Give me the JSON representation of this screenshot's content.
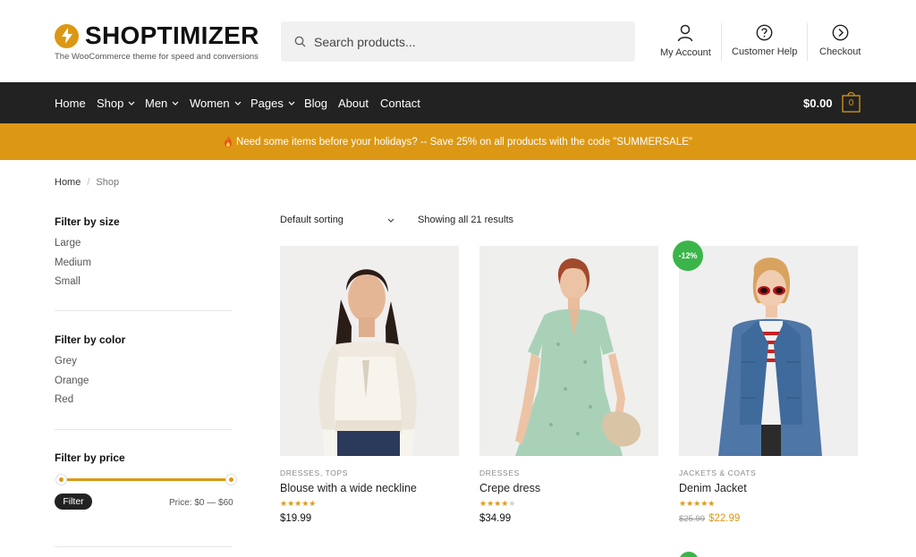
{
  "brand": {
    "name": "SHOPTIMIZER",
    "tagline": "The WooCommerce theme for speed and conversions"
  },
  "search": {
    "placeholder": "Search products..."
  },
  "header_links": {
    "account": "My Account",
    "help": "Customer Help",
    "checkout": "Checkout"
  },
  "nav": {
    "items": [
      {
        "label": "Home"
      },
      {
        "label": "Shop"
      },
      {
        "label": "Men"
      },
      {
        "label": "Women"
      },
      {
        "label": "Pages"
      },
      {
        "label": "Blog"
      },
      {
        "label": "About"
      },
      {
        "label": "Contact"
      }
    ],
    "cart_amount": "$0.00",
    "cart_count": "0"
  },
  "promo": {
    "text": "Need some items before your holidays? -- Save 25% on all products with the code \"SUMMERSALE\""
  },
  "breadcrumb": {
    "home": "Home",
    "current": "Shop"
  },
  "sidebar": {
    "size": {
      "title": "Filter by size",
      "options": [
        "Large",
        "Medium",
        "Small"
      ]
    },
    "color": {
      "title": "Filter by color",
      "options": [
        "Grey",
        "Orange",
        "Red"
      ]
    },
    "price": {
      "title": "Filter by price",
      "button": "Filter",
      "range_label": "Price: $0 — $60",
      "min": 0,
      "max": 60
    }
  },
  "toolbar": {
    "sorting": "Default sorting",
    "results": "Showing all 21 results"
  },
  "products": [
    {
      "category": "DRESSES, TOPS",
      "title": "Blouse with a wide neckline",
      "rating": 5,
      "price": "$19.99"
    },
    {
      "category": "DRESSES",
      "title": "Crepe dress",
      "rating": 4,
      "price": "$34.99"
    },
    {
      "category": "JACKETS & COATS",
      "title": "Denim Jacket",
      "rating": 5,
      "old_price": "$25.99",
      "price": "$22.99",
      "badge": "-12%"
    }
  ],
  "colors": {
    "accent": "#dc9814",
    "nav_bg": "#222222",
    "sale": "#3bb54a"
  }
}
